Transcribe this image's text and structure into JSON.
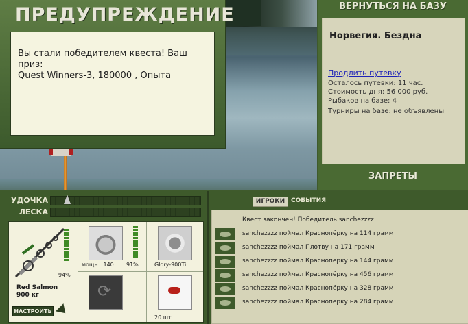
{
  "warning": {
    "title": "ПРЕДУПРЕЖДЕНИЕ",
    "message_line1": "Вы стали победителем квеста! Ваш приз:",
    "message_line2": "Quest Winners-3, 180000 , Опыта"
  },
  "location": {
    "back_button": "ВЕРНУТЬСЯ НА БАЗУ",
    "name": "Норвегия. Бездна",
    "extend_link": "Продлить путевку",
    "time_left": "Осталось путевки: 11 час.",
    "day_cost": "Стоимость дня: 56 000 руб.",
    "fishers": "Рыбаков на базе: 4",
    "tournaments": "Турниры на базе: не объявлены",
    "bans_button": "ЗАПРЕТЫ"
  },
  "meters": {
    "rod_label": "УДОЧКА",
    "line_label": "ЛЕСКА",
    "rod_level": 0.1,
    "line_level": 0.0
  },
  "tackle": {
    "rod_wear_pct": "94%",
    "fish_name": "Red Salmon",
    "fish_weight": "900 кг",
    "setup_button": "НАСТРОИТЬ",
    "reel_power": "мощн.: 140",
    "reel_wear_pct": "91%",
    "line_name": "Glory-900Ti",
    "bait_count": "20 шт."
  },
  "events": {
    "tab_players": "ИГРОКИ",
    "tab_events": "СОБЫТИЯ",
    "header": "Квест закончен! Победитель sanchezzzz",
    "items": [
      "sanchezzzz поймал Краснопёрку на 114 грамм",
      "sanchezzzz поймал Плотву на 171 грамм",
      "sanchezzzz поймал Краснопёрку на 144 грамм",
      "sanchezzzz поймал Краснопёрку на 456 грамм",
      "sanchezzzz поймал Краснопёрку на 328 грамм",
      "sanchezzzz поймал Краснопёрку на 284 грамм"
    ]
  }
}
